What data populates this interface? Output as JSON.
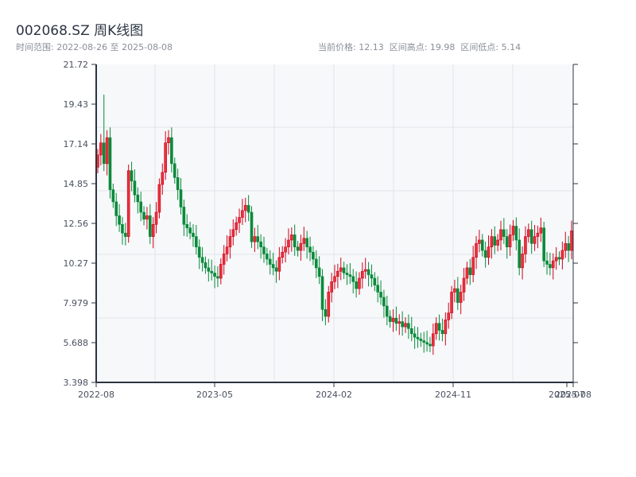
{
  "header": {
    "title": "002068.SZ 周K线图",
    "range_label": "时间范围: 2022-08-26 至 2025-08-08",
    "current_label": "当前价格: 12.13",
    "high_label": "区间高点: 19.98",
    "low_label": "区间低点: 5.14"
  },
  "chart_data": {
    "type": "candlestick",
    "title": "002068.SZ 周K线图",
    "xlabel": "",
    "ylabel": "",
    "ylim": [
      3.398,
      21.72
    ],
    "yticks": [
      "3.398",
      "5.688",
      "7.979",
      "10.27",
      "12.56",
      "14.85",
      "17.14",
      "19.43",
      "21.72"
    ],
    "xticks": [
      "2022-08",
      "2023-05",
      "2024-02",
      "2024-11",
      "2025-07",
      "2025-08"
    ],
    "start_date": "2022-08-26",
    "end_date": "2025-08-08",
    "interval": "weekly",
    "first_open": 15.8,
    "close": [
      16.5,
      17.2,
      16.0,
      17.5,
      14.5,
      13.8,
      13.0,
      12.5,
      12.0,
      11.8,
      15.6,
      15.0,
      14.2,
      13.8,
      13.2,
      12.8,
      13.0,
      11.8,
      12.5,
      13.2,
      14.8,
      15.5,
      17.2,
      17.5,
      16.0,
      15.2,
      14.5,
      13.5,
      12.5,
      12.3,
      12.0,
      11.8,
      11.2,
      10.6,
      10.3,
      10.0,
      9.8,
      9.7,
      9.5,
      9.4,
      10.2,
      10.8,
      11.2,
      11.8,
      12.2,
      12.6,
      12.9,
      13.3,
      13.6,
      13.2,
      11.5,
      11.8,
      11.5,
      11.2,
      10.8,
      10.5,
      10.2,
      10.0,
      9.8,
      10.6,
      10.9,
      11.2,
      11.6,
      11.9,
      11.2,
      11.0,
      11.4,
      11.7,
      11.2,
      10.9,
      10.5,
      10.0,
      9.5,
      7.6,
      7.2,
      8.6,
      9.2,
      9.5,
      9.8,
      10.0,
      9.7,
      9.6,
      9.5,
      9.2,
      8.8,
      9.4,
      9.8,
      9.9,
      9.6,
      9.4,
      9.0,
      8.6,
      8.3,
      7.8,
      7.2,
      6.9,
      7.1,
      6.8,
      6.9,
      6.6,
      6.8,
      6.5,
      6.2,
      6.0,
      5.9,
      5.8,
      5.7,
      5.6,
      5.5,
      6.2,
      6.8,
      6.4,
      6.2,
      7.0,
      7.4,
      8.6,
      8.8,
      8.0,
      8.6,
      9.4,
      10.0,
      9.6,
      10.6,
      11.4,
      11.6,
      11.0,
      10.6,
      11.2,
      11.8,
      11.3,
      11.6,
      12.2,
      11.8,
      11.2,
      11.9,
      12.4,
      11.6,
      10.0,
      10.8,
      11.8,
      12.2,
      11.4,
      11.8,
      12.0,
      12.3,
      10.4,
      10.2,
      10.0,
      10.4,
      10.6,
      10.5,
      11.0,
      11.4,
      11.0,
      12.13
    ],
    "period_high": 19.98,
    "period_low": 5.14,
    "up_color": "#d0021b",
    "down_color": "#0a8a3a",
    "grid": true
  }
}
